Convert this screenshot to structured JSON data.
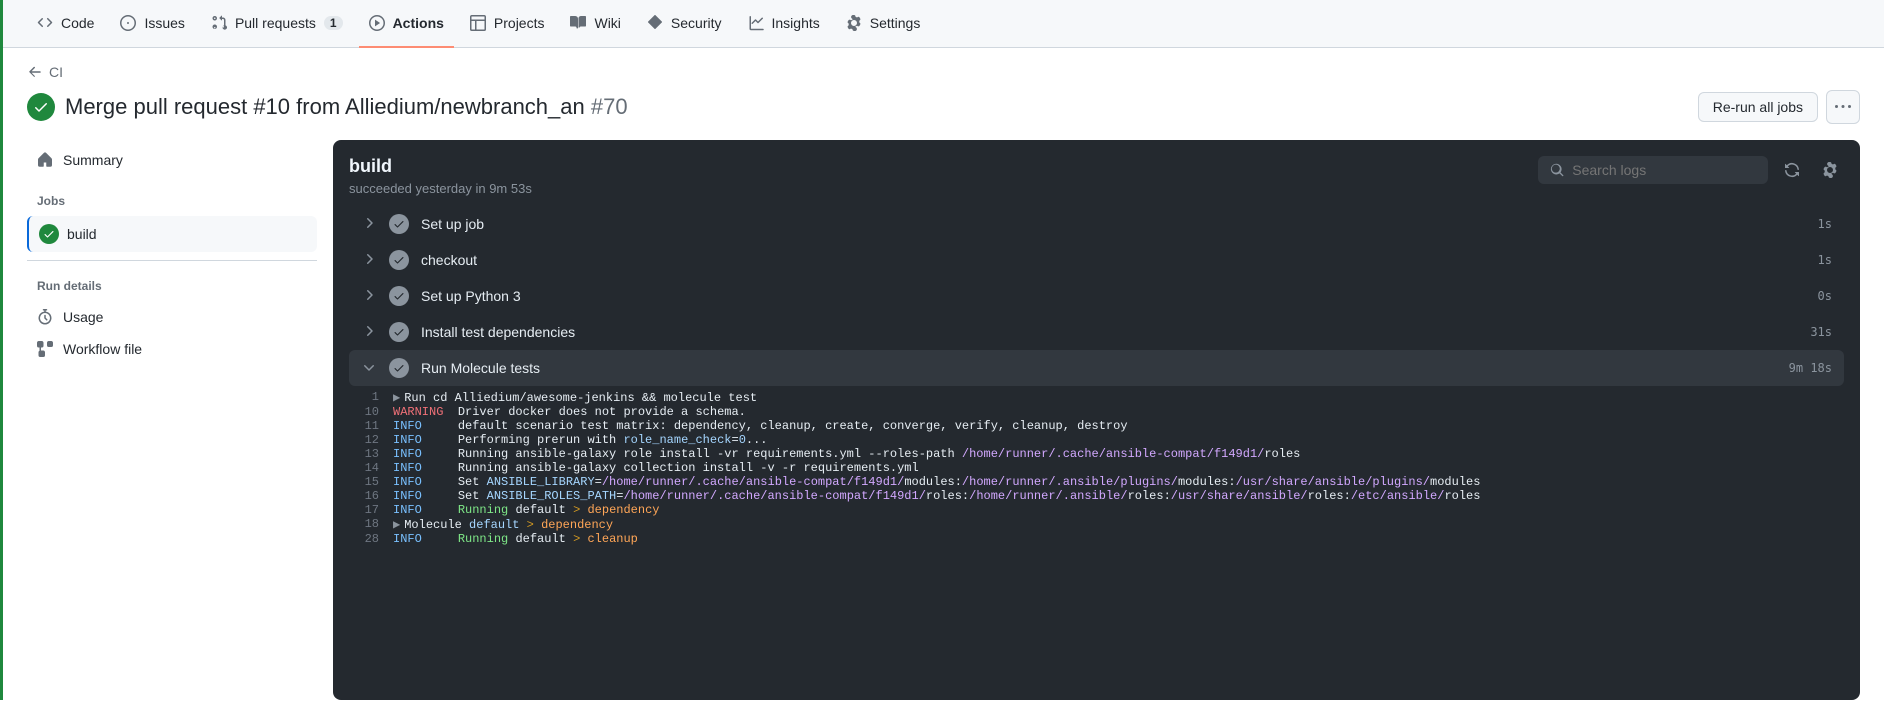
{
  "pull_count": "1",
  "tabs": {
    "code": "Code",
    "issues": "Issues",
    "pulls": "Pull requests",
    "actions": "Actions",
    "projects": "Projects",
    "wiki": "Wiki",
    "security": "Security",
    "insights": "Insights",
    "settings": "Settings"
  },
  "back": "CI",
  "title": "Merge pull request #10 from Alliedium/newbranch_an",
  "run_hash": "#70",
  "rerun": "Re-run all jobs",
  "sidebar": {
    "summary": "Summary",
    "jobs_label": "Jobs",
    "job_build": "build",
    "run_details": "Run details",
    "usage": "Usage",
    "workflow": "Workflow file"
  },
  "job": {
    "name": "build",
    "status_line": "succeeded yesterday in 9m 53s",
    "search_placeholder": "Search logs"
  },
  "steps": [
    {
      "name": "Set up job",
      "dur": "1s",
      "expanded": false
    },
    {
      "name": "checkout",
      "dur": "1s",
      "expanded": false
    },
    {
      "name": "Set up Python 3",
      "dur": "0s",
      "expanded": false
    },
    {
      "name": "Install test dependencies",
      "dur": "31s",
      "expanded": false
    },
    {
      "name": "Run Molecule tests",
      "dur": "9m 18s",
      "expanded": true
    }
  ],
  "logs": [
    {
      "n": "1",
      "caret": "▶",
      "segs": [
        {
          "t": "Run cd Alliedium/awesome-jenkins && molecule test",
          "c": ""
        }
      ]
    },
    {
      "n": "10",
      "segs": [
        {
          "t": "WARNING",
          "c": "t-warn"
        },
        {
          "t": "  Driver docker does not provide a schema.",
          "c": ""
        }
      ]
    },
    {
      "n": "11",
      "segs": [
        {
          "t": "INFO",
          "c": "t-info"
        },
        {
          "t": "     default scenario test matrix: dependency, cleanup, create, converge, verify, cleanup, destroy",
          "c": ""
        }
      ]
    },
    {
      "n": "12",
      "segs": [
        {
          "t": "INFO",
          "c": "t-info"
        },
        {
          "t": "     Performing prerun with ",
          "c": ""
        },
        {
          "t": "role_name_check",
          "c": "t-cyan"
        },
        {
          "t": "=",
          "c": ""
        },
        {
          "t": "0",
          "c": "t-cyan"
        },
        {
          "t": "...",
          "c": ""
        }
      ]
    },
    {
      "n": "13",
      "segs": [
        {
          "t": "INFO",
          "c": "t-info"
        },
        {
          "t": "     Running ansible-galaxy role install -vr requirements.yml --roles-path ",
          "c": ""
        },
        {
          "t": "/home/runner/.cache/ansible-compat/f149d1/",
          "c": "t-purple"
        },
        {
          "t": "roles",
          "c": ""
        }
      ]
    },
    {
      "n": "14",
      "segs": [
        {
          "t": "INFO",
          "c": "t-info"
        },
        {
          "t": "     Running ansible-galaxy collection install -v -r requirements.yml",
          "c": ""
        }
      ]
    },
    {
      "n": "15",
      "segs": [
        {
          "t": "INFO",
          "c": "t-info"
        },
        {
          "t": "     Set ",
          "c": ""
        },
        {
          "t": "ANSIBLE_LIBRARY",
          "c": "t-cyan"
        },
        {
          "t": "=",
          "c": ""
        },
        {
          "t": "/home/runner/.cache/ansible-compat/f149d1/",
          "c": "t-purple"
        },
        {
          "t": "modules:",
          "c": ""
        },
        {
          "t": "/home/runner/.ansible/plugins/",
          "c": "t-purple"
        },
        {
          "t": "modules:",
          "c": ""
        },
        {
          "t": "/usr/share/ansible/plugins/",
          "c": "t-purple"
        },
        {
          "t": "modules",
          "c": ""
        }
      ]
    },
    {
      "n": "16",
      "segs": [
        {
          "t": "INFO",
          "c": "t-info"
        },
        {
          "t": "     Set ",
          "c": ""
        },
        {
          "t": "ANSIBLE_ROLES_PATH",
          "c": "t-cyan"
        },
        {
          "t": "=",
          "c": ""
        },
        {
          "t": "/home/runner/.cache/ansible-compat/f149d1/",
          "c": "t-purple"
        },
        {
          "t": "roles:",
          "c": ""
        },
        {
          "t": "/home/runner/.ansible/",
          "c": "t-purple"
        },
        {
          "t": "roles:",
          "c": ""
        },
        {
          "t": "/usr/share/ansible/",
          "c": "t-purple"
        },
        {
          "t": "roles:",
          "c": ""
        },
        {
          "t": "/etc/ansible/",
          "c": "t-purple"
        },
        {
          "t": "roles",
          "c": ""
        }
      ]
    },
    {
      "n": "17",
      "segs": [
        {
          "t": "INFO",
          "c": "t-info"
        },
        {
          "t": "     ",
          "c": ""
        },
        {
          "t": "Running",
          "c": "t-green"
        },
        {
          "t": " default ",
          "c": ""
        },
        {
          "t": ">",
          "c": "t-yellow"
        },
        {
          "t": " dependency",
          "c": "t-orange"
        }
      ]
    },
    {
      "n": "18",
      "caret": "▶",
      "segs": [
        {
          "t": "Molecule ",
          "c": ""
        },
        {
          "t": "default ",
          "c": "t-cyan"
        },
        {
          "t": "> ",
          "c": "t-yellow"
        },
        {
          "t": "dependency",
          "c": "t-orange"
        }
      ]
    },
    {
      "n": "28",
      "segs": [
        {
          "t": "INFO",
          "c": "t-info"
        },
        {
          "t": "     ",
          "c": ""
        },
        {
          "t": "Running",
          "c": "t-green"
        },
        {
          "t": " default ",
          "c": ""
        },
        {
          "t": ">",
          "c": "t-yellow"
        },
        {
          "t": " cleanup",
          "c": "t-orange"
        }
      ]
    }
  ]
}
